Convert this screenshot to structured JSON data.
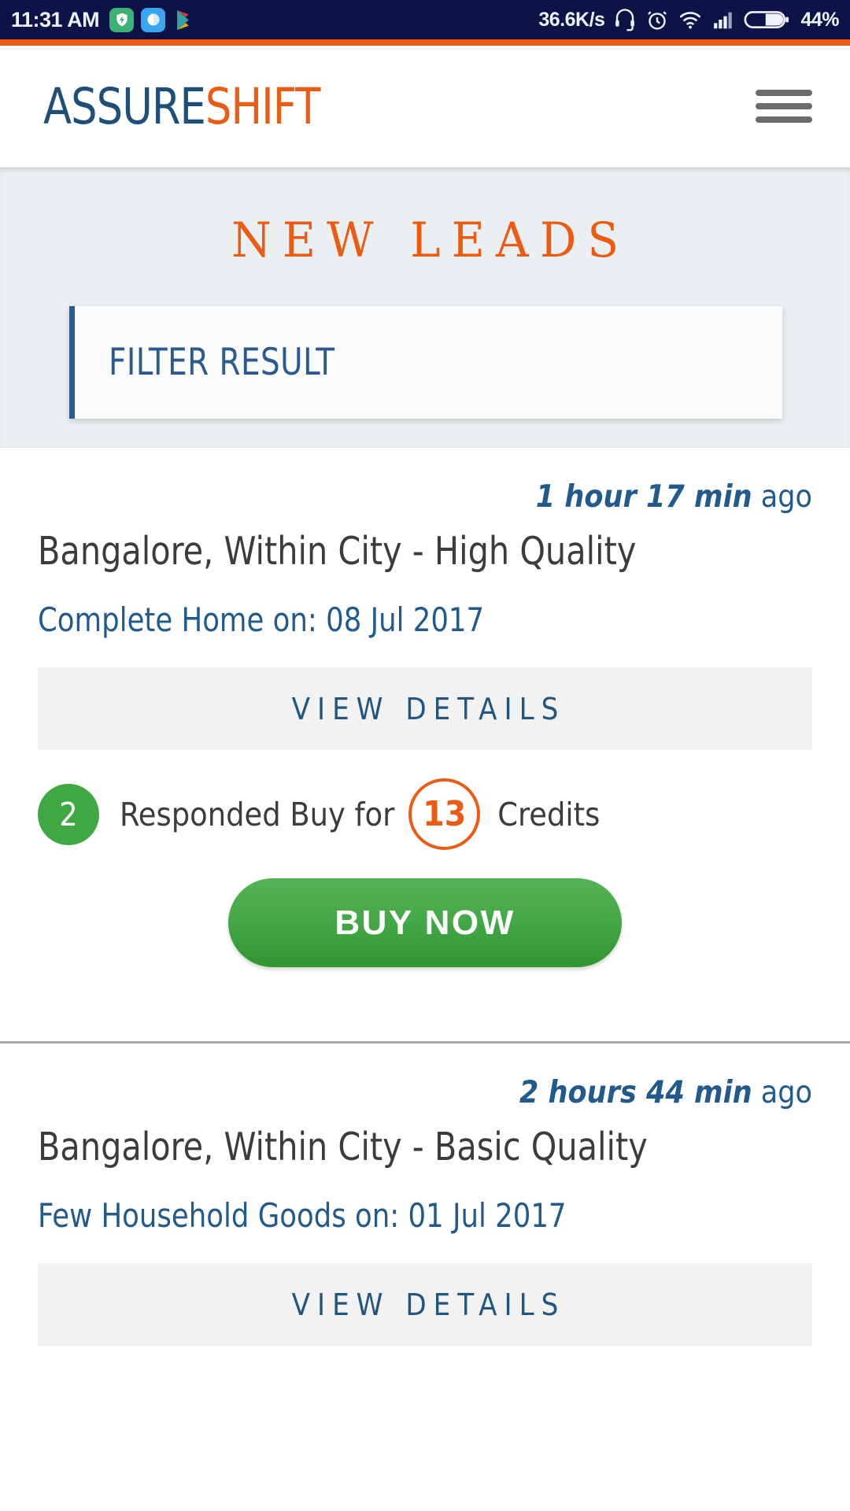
{
  "status_bar": {
    "time": "11:31 AM",
    "network_speed": "36.6K/s",
    "battery_percent": "44%",
    "app_icons": [
      "shield-app-icon",
      "browser-app-icon",
      "play-store-icon"
    ],
    "indicator_icons": [
      "headset-icon",
      "alarm-icon",
      "wifi-icon",
      "signal-icon",
      "battery-icon"
    ],
    "background_color": "#0d1347"
  },
  "header": {
    "logo_part1": "ASSURE",
    "logo_part2": "SHIFT",
    "logo_color_1": "#1f4e79",
    "logo_color_2": "#ec5b12",
    "menu_label": "menu"
  },
  "hero": {
    "title": "NEW LEADS",
    "title_color": "#ec5b12",
    "filter_label": "FILTER RESULT",
    "filter_accent_color": "#2c5a8f"
  },
  "leads": [
    {
      "time_relative": "1 hour 17 min",
      "time_suffix": "ago",
      "title": "Bangalore, Within City - High Quality",
      "subtitle": "Complete Home on: 08 Jul 2017",
      "view_details_label": "VIEW DETAILS",
      "responded_count": "2",
      "responded_text": "Responded Buy for",
      "credits": "13",
      "credits_unit": "Credits",
      "buy_label": "BUY NOW",
      "buy_color": "#45a846"
    },
    {
      "time_relative": "2 hours 44 min",
      "time_suffix": "ago",
      "title": "Bangalore, Within City - Basic Quality",
      "subtitle": "Few Household Goods on: 01 Jul 2017",
      "view_details_label": "VIEW DETAILS"
    }
  ]
}
